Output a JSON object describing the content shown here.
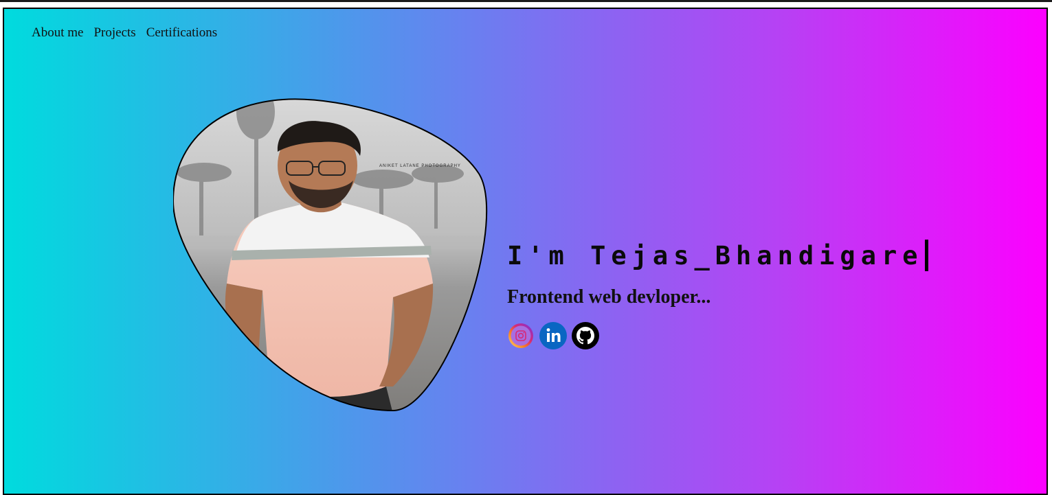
{
  "nav": {
    "items": [
      "About me",
      "Projects",
      "Certifications"
    ]
  },
  "hero": {
    "headline": "I'm Tejas_Bhandigare",
    "subtitle": "Frontend web devloper...",
    "photo_watermark": "ANIKET LATANE PHOTOGRAPHY"
  },
  "social": {
    "icons": [
      "instagram-icon",
      "linkedin-icon",
      "github-icon"
    ]
  },
  "colors": {
    "gradient_start": "#00dbde",
    "gradient_end": "#fc00ff",
    "linkedin_blue": "#0a66c2",
    "shirt_pink": "#f4c0b0"
  }
}
